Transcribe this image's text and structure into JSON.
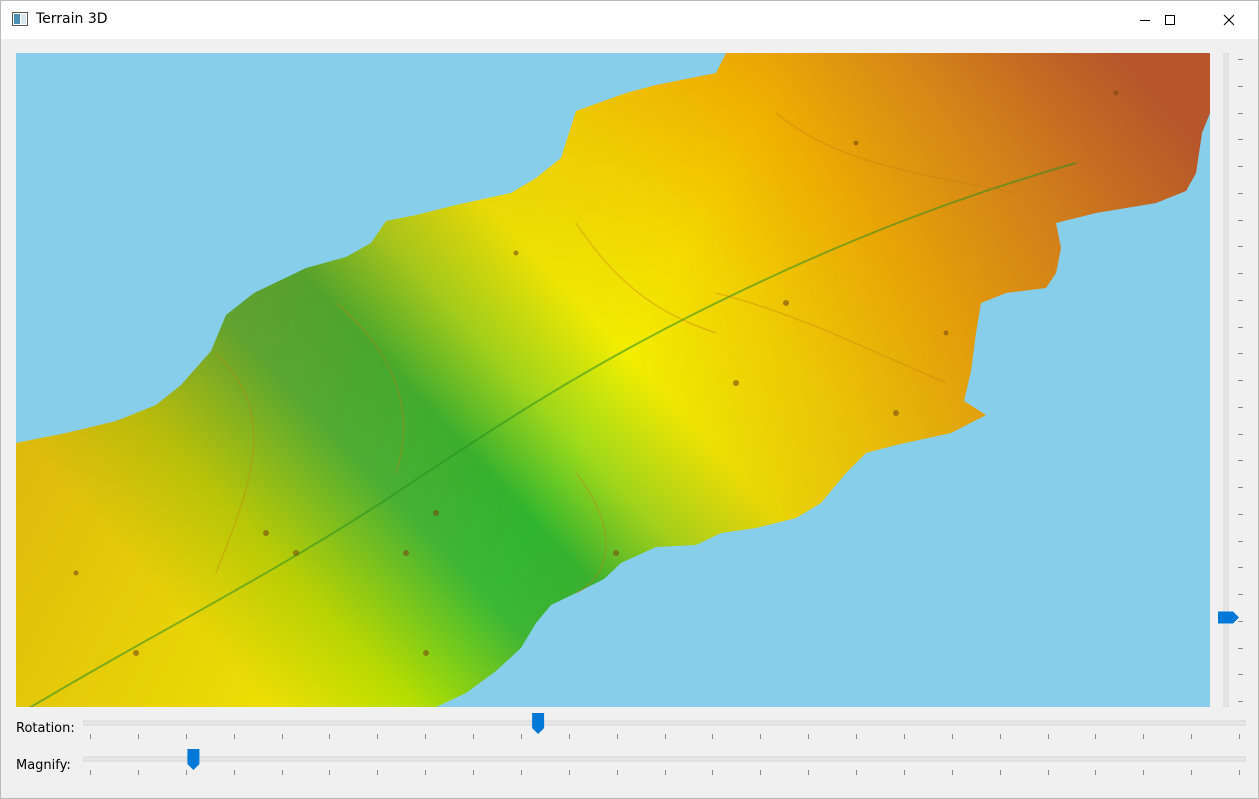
{
  "window": {
    "title": "Terrain 3D",
    "controls": [
      "minimize",
      "maximize",
      "close"
    ]
  },
  "colors": {
    "sky": "#87ceeb",
    "accent": "#0078d7",
    "terrain_low": "#2fb52f",
    "terrain_mid": "#f2ee00",
    "terrain_high": "#b4522c"
  },
  "viewport": {
    "content": "3D shaded terrain elevation surface",
    "icons": [
      "terrain-surface"
    ]
  },
  "sliders": {
    "elevation": {
      "orientation": "vertical",
      "value_fraction": 0.13,
      "ticks": 25
    },
    "rotation": {
      "label": "Rotation:",
      "value_fraction": 0.39,
      "ticks": 25
    },
    "magnify": {
      "label": "Magnify:",
      "value_fraction": 0.09,
      "ticks": 25
    }
  }
}
